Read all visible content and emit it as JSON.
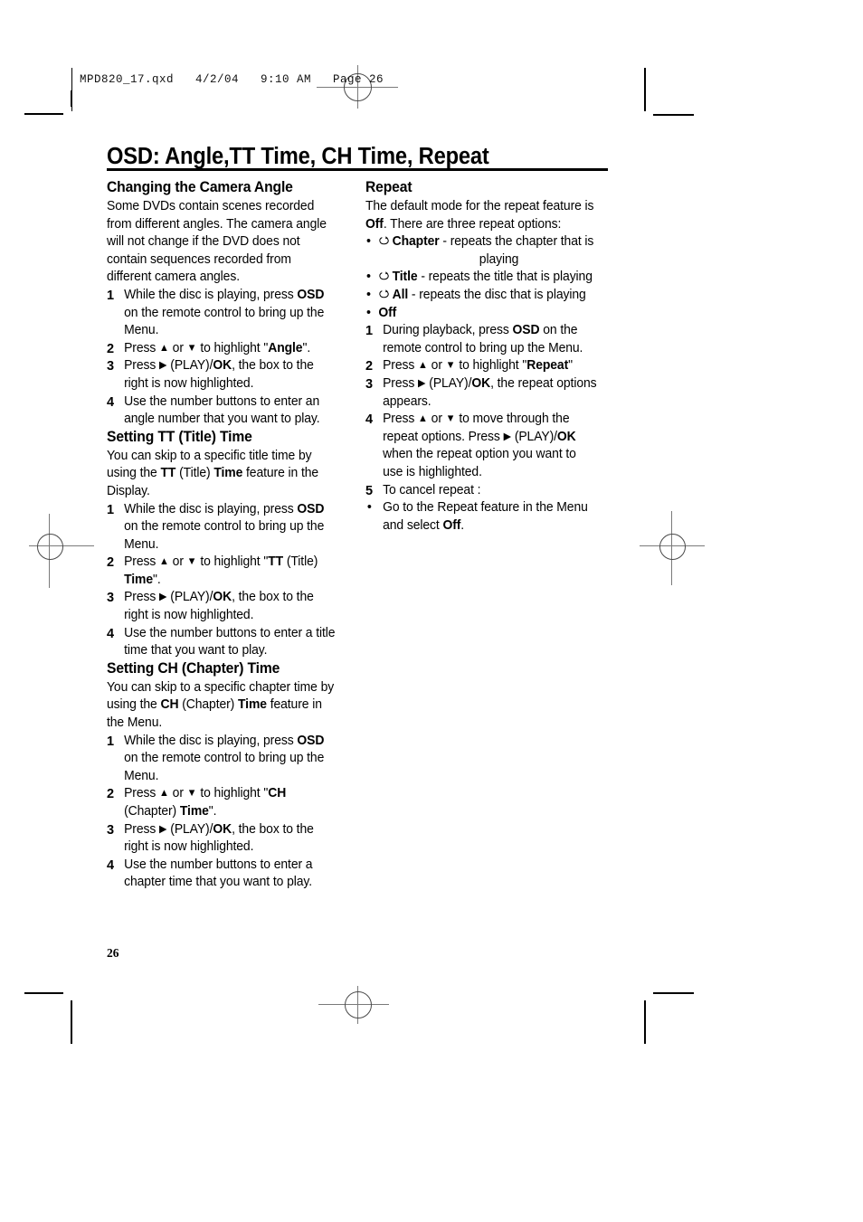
{
  "proof_slug": "MPD820_17.qxd   4/2/04   9:10 AM   Page 26",
  "page_title": "OSD: Angle,TT Time, CH Time, Repeat",
  "page_number": "26",
  "icons": {
    "repeat_loop": "repeat-loop-icon"
  },
  "colors": {
    "text": "#000000",
    "rule": "#000000",
    "mark": "#7a7a7a",
    "page_bg": "#ffffff"
  },
  "left_column": {
    "sections": [
      {
        "heading": "Changing the Camera Angle",
        "intro": "Some DVDs contain scenes recorded from different angles. The camera angle will not change if the DVD does not contain sequences recorded from different camera angles.",
        "steps": [
          {
            "num": "1",
            "parts": [
              {
                "t": "While the disc is playing, press ",
                "b": false
              },
              {
                "t": "OSD",
                "b": true
              },
              {
                "t": " on the remote control to bring up the Menu.",
                "b": false
              }
            ]
          },
          {
            "num": "2",
            "parts": [
              {
                "t": "Press ",
                "b": false
              },
              {
                "t": "▲",
                "b": false,
                "arrow": true
              },
              {
                "t": " or ",
                "b": false
              },
              {
                "t": "▼",
                "b": false,
                "arrow": true
              },
              {
                "t": " to highlight \"",
                "b": false
              },
              {
                "t": "Angle",
                "b": true
              },
              {
                "t": "\".",
                "b": false
              }
            ]
          },
          {
            "num": "3",
            "parts": [
              {
                "t": "Press ",
                "b": false
              },
              {
                "t": "▶",
                "b": false,
                "arrow": true
              },
              {
                "t": " (PLAY)/",
                "b": false
              },
              {
                "t": "OK",
                "b": true
              },
              {
                "t": ", the box to the right is now highlighted.",
                "b": false
              }
            ]
          },
          {
            "num": "4",
            "parts": [
              {
                "t": "Use the number buttons to enter an angle number that you want to play.",
                "b": false
              }
            ]
          }
        ]
      },
      {
        "heading": "Setting TT (Title) Time",
        "intro_parts": [
          {
            "t": "You can skip to a specific title time by using the ",
            "b": false
          },
          {
            "t": "TT",
            "b": true
          },
          {
            "t": " (Title) ",
            "b": false
          },
          {
            "t": "Time",
            "b": true
          },
          {
            "t": " feature in the Display.",
            "b": false
          }
        ],
        "steps": [
          {
            "num": "1",
            "parts": [
              {
                "t": "While the disc is playing, press ",
                "b": false
              },
              {
                "t": "OSD",
                "b": true
              },
              {
                "t": " on the remote control to bring up the Menu.",
                "b": false
              }
            ]
          },
          {
            "num": "2",
            "parts": [
              {
                "t": "Press ",
                "b": false
              },
              {
                "t": "▲",
                "b": false,
                "arrow": true
              },
              {
                "t": " or ",
                "b": false
              },
              {
                "t": "▼",
                "b": false,
                "arrow": true
              },
              {
                "t": " to highlight \"",
                "b": false
              },
              {
                "t": "TT",
                "b": true
              },
              {
                "t": " (Title) ",
                "b": false
              },
              {
                "t": "Time",
                "b": true
              },
              {
                "t": "\".",
                "b": false
              }
            ]
          },
          {
            "num": "3",
            "parts": [
              {
                "t": "Press ",
                "b": false
              },
              {
                "t": "▶",
                "b": false,
                "arrow": true
              },
              {
                "t": " (PLAY)/",
                "b": false
              },
              {
                "t": "OK",
                "b": true
              },
              {
                "t": ", the box to the right is now highlighted.",
                "b": false
              }
            ]
          },
          {
            "num": "4",
            "parts": [
              {
                "t": "Use the number buttons to enter a title time that you want to play.",
                "b": false
              }
            ]
          }
        ]
      },
      {
        "heading": "Setting CH (Chapter) Time",
        "intro_parts": [
          {
            "t": "You can skip to a specific chapter time by using the ",
            "b": false
          },
          {
            "t": "CH",
            "b": true
          },
          {
            "t": " (Chapter) ",
            "b": false
          },
          {
            "t": "Time",
            "b": true
          },
          {
            "t": " feature in the Menu.",
            "b": false
          }
        ],
        "steps": [
          {
            "num": "1",
            "parts": [
              {
                "t": "While the disc is playing, press ",
                "b": false
              },
              {
                "t": "OSD",
                "b": true
              },
              {
                "t": " on the remote control to bring up the Menu.",
                "b": false
              }
            ]
          },
          {
            "num": "2",
            "parts": [
              {
                "t": "Press ",
                "b": false
              },
              {
                "t": "▲",
                "b": false,
                "arrow": true
              },
              {
                "t": " or ",
                "b": false
              },
              {
                "t": "▼",
                "b": false,
                "arrow": true
              },
              {
                "t": " to highlight \"",
                "b": false
              },
              {
                "t": "CH",
                "b": true
              },
              {
                "t": " (Chapter) ",
                "b": false
              },
              {
                "t": "Time",
                "b": true
              },
              {
                "t": "\".",
                "b": false
              }
            ]
          },
          {
            "num": "3",
            "parts": [
              {
                "t": "Press ",
                "b": false
              },
              {
                "t": "▶",
                "b": false,
                "arrow": true
              },
              {
                "t": " (PLAY)/",
                "b": false
              },
              {
                "t": "OK",
                "b": true
              },
              {
                "t": ", the box to the right is now highlighted.",
                "b": false
              }
            ]
          },
          {
            "num": "4",
            "parts": [
              {
                "t": "Use the number buttons to enter a chapter time that you want to play.",
                "b": false
              }
            ]
          }
        ]
      }
    ]
  },
  "right_column": {
    "heading": "Repeat",
    "intro_parts": [
      {
        "t": "The default mode for the repeat feature is ",
        "b": false
      },
      {
        "t": "Off",
        "b": true
      },
      {
        "t": ". There are three repeat options:",
        "b": false
      }
    ],
    "options": [
      {
        "icon": true,
        "label": "Chapter",
        "desc": " - repeats the chapter that is",
        "continuation": "playing"
      },
      {
        "icon": true,
        "label": "Title",
        "desc": " - repeats the title that is playing"
      },
      {
        "icon": true,
        "label": "All",
        "desc": " - repeats the disc that is playing"
      },
      {
        "icon": false,
        "label": "Off",
        "desc": ""
      }
    ],
    "steps": [
      {
        "num": "1",
        "parts": [
          {
            "t": "During playback, press ",
            "b": false
          },
          {
            "t": "OSD",
            "b": true
          },
          {
            "t": " on the remote control to bring up the Menu.",
            "b": false
          }
        ]
      },
      {
        "num": "2",
        "parts": [
          {
            "t": "Press ",
            "b": false
          },
          {
            "t": "▲",
            "b": false,
            "arrow": true
          },
          {
            "t": " or ",
            "b": false
          },
          {
            "t": "▼",
            "b": false,
            "arrow": true
          },
          {
            "t": " to highlight \"",
            "b": false
          },
          {
            "t": "Repeat",
            "b": true
          },
          {
            "t": "\"",
            "b": false
          }
        ]
      },
      {
        "num": "3",
        "parts": [
          {
            "t": "Press ",
            "b": false
          },
          {
            "t": "▶",
            "b": false,
            "arrow": true
          },
          {
            "t": " (PLAY)/",
            "b": false
          },
          {
            "t": "OK",
            "b": true
          },
          {
            "t": ", the repeat options appears.",
            "b": false
          }
        ]
      },
      {
        "num": "4",
        "parts": [
          {
            "t": "Press ",
            "b": false
          },
          {
            "t": "▲",
            "b": false,
            "arrow": true
          },
          {
            "t": " or ",
            "b": false
          },
          {
            "t": "▼",
            "b": false,
            "arrow": true
          },
          {
            "t": " to move through the repeat options. Press ",
            "b": false
          },
          {
            "t": "▶",
            "b": false,
            "arrow": true
          },
          {
            "t": " (PLAY)/",
            "b": false
          },
          {
            "t": "OK",
            "b": true
          },
          {
            "t": " when the repeat option you want to use is highlighted.",
            "b": false
          }
        ]
      },
      {
        "num": "5",
        "parts": [
          {
            "t": "To cancel repeat :",
            "b": false
          }
        ]
      },
      {
        "num": "•",
        "bullet": true,
        "parts": [
          {
            "t": "Go to the Repeat feature in the Menu and select ",
            "b": false
          },
          {
            "t": "Off",
            "b": true
          },
          {
            "t": ".",
            "b": false
          }
        ]
      }
    ]
  }
}
